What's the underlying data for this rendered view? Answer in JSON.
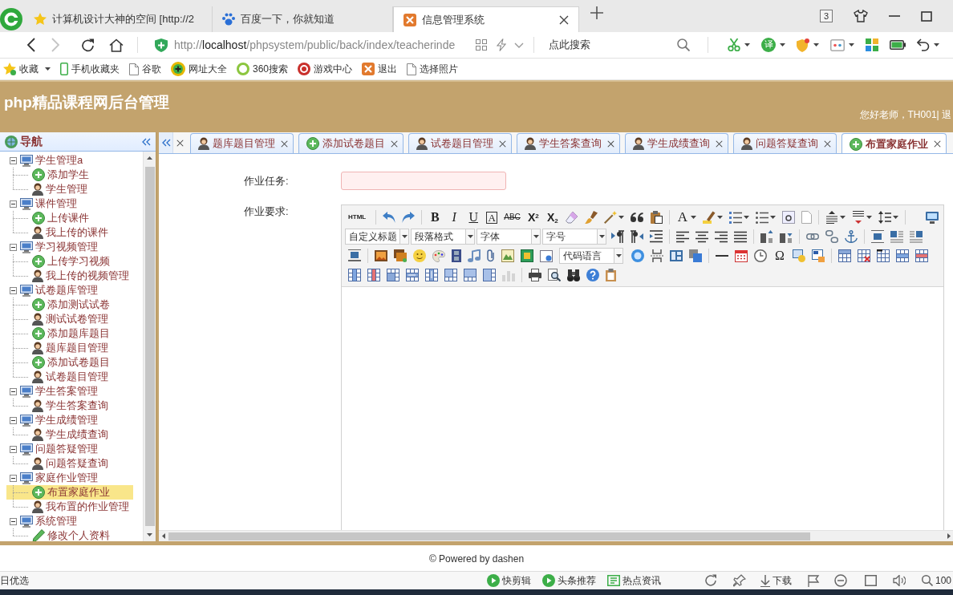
{
  "browser": {
    "tabs": [
      {
        "title": "计算机设计大神的空间 [http://2",
        "selected": false
      },
      {
        "title": "百度一下，你就知道",
        "selected": false
      },
      {
        "title": "信息管理系统",
        "selected": true
      }
    ],
    "tab_count": "3",
    "address": {
      "scheme": "http://",
      "host": "localhost",
      "path": "/phpsystem/public/back/index/teacherinde"
    },
    "search": {
      "placeholder": "点此搜索"
    },
    "translate_label": "译",
    "bookmarks": [
      "收藏",
      "手机收藏夹",
      "谷歌",
      "网址大全",
      "360搜索",
      "游戏中心",
      "退出",
      "选择照片"
    ]
  },
  "app": {
    "title": "php精品课程网后台管理",
    "greeting": "您好老师，TH001| 退"
  },
  "sidebar": {
    "title": "导航",
    "tree": [
      {
        "label": "学生管理a",
        "expanded": true,
        "selected": false,
        "children": [
          {
            "label": "添加学生",
            "kind": "add",
            "selected": false
          },
          {
            "label": "学生管理",
            "kind": "manage",
            "selected": false
          }
        ]
      },
      {
        "label": "课件管理",
        "expanded": true,
        "selected": false,
        "children": [
          {
            "label": "上传课件",
            "kind": "add",
            "selected": false
          },
          {
            "label": "我上传的课件",
            "kind": "manage",
            "selected": false
          }
        ]
      },
      {
        "label": "学习视频管理",
        "expanded": true,
        "selected": false,
        "children": [
          {
            "label": "上传学习视频",
            "kind": "add",
            "selected": false
          },
          {
            "label": "我上传的视频管理",
            "kind": "manage",
            "selected": false
          }
        ]
      },
      {
        "label": "试卷题库管理",
        "expanded": true,
        "selected": false,
        "children": [
          {
            "label": "添加测试试卷",
            "kind": "add",
            "selected": false
          },
          {
            "label": "测试试卷管理",
            "kind": "manage",
            "selected": false
          },
          {
            "label": "添加题库题目",
            "kind": "add",
            "selected": false
          },
          {
            "label": "题库题目管理",
            "kind": "manage",
            "selected": false
          },
          {
            "label": "添加试卷题目",
            "kind": "add",
            "selected": false
          },
          {
            "label": "试卷题目管理",
            "kind": "manage",
            "selected": false
          }
        ]
      },
      {
        "label": "学生答案管理",
        "expanded": true,
        "selected": false,
        "children": [
          {
            "label": "学生答案查询",
            "kind": "manage",
            "selected": false
          }
        ]
      },
      {
        "label": "学生成绩管理",
        "expanded": true,
        "selected": false,
        "children": [
          {
            "label": "学生成绩查询",
            "kind": "manage",
            "selected": false
          }
        ]
      },
      {
        "label": "问题答疑管理",
        "expanded": true,
        "selected": false,
        "children": [
          {
            "label": "问题答疑查询",
            "kind": "manage",
            "selected": false
          }
        ]
      },
      {
        "label": "家庭作业管理",
        "expanded": true,
        "selected": false,
        "children": [
          {
            "label": "布置家庭作业",
            "kind": "add",
            "selected": true
          },
          {
            "label": "我布置的作业管理",
            "kind": "manage",
            "selected": false
          }
        ]
      },
      {
        "label": "系统管理",
        "expanded": true,
        "selected": false,
        "children": [
          {
            "label": "修改个人资料",
            "kind": "edit",
            "selected": false
          }
        ]
      }
    ]
  },
  "tabs": [
    {
      "label": "题库题目管理",
      "kind": "manage",
      "selected": false
    },
    {
      "label": "添加试卷题目",
      "kind": "add",
      "selected": false
    },
    {
      "label": "试卷题目管理",
      "kind": "manage",
      "selected": false
    },
    {
      "label": "学生答案查询",
      "kind": "manage",
      "selected": false
    },
    {
      "label": "学生成绩查询",
      "kind": "manage",
      "selected": false
    },
    {
      "label": "问题答疑查询",
      "kind": "manage",
      "selected": false
    },
    {
      "label": "布置家庭作业",
      "kind": "add",
      "selected": true
    }
  ],
  "form": {
    "task": {
      "label": "作业任务:",
      "invalid": true
    },
    "requirements": {
      "label": "作业要求:"
    }
  },
  "editor": {
    "glyphs": [
      "HTML",
      "B",
      "I",
      "U",
      "A",
      "ABC",
      "X$^{2}$",
      "X$_{2}$",
      "A",
      "Ω"
    ],
    "selects": [
      "自定义标题",
      "段落格式",
      "字体",
      "字号",
      "代码语言"
    ]
  },
  "footer": "© Powered by dashen",
  "status_bar": {
    "left": "日优选",
    "items": [
      "快剪辑",
      "头条推荐",
      "热点资讯",
      "下载"
    ],
    "zoom": "100"
  }
}
